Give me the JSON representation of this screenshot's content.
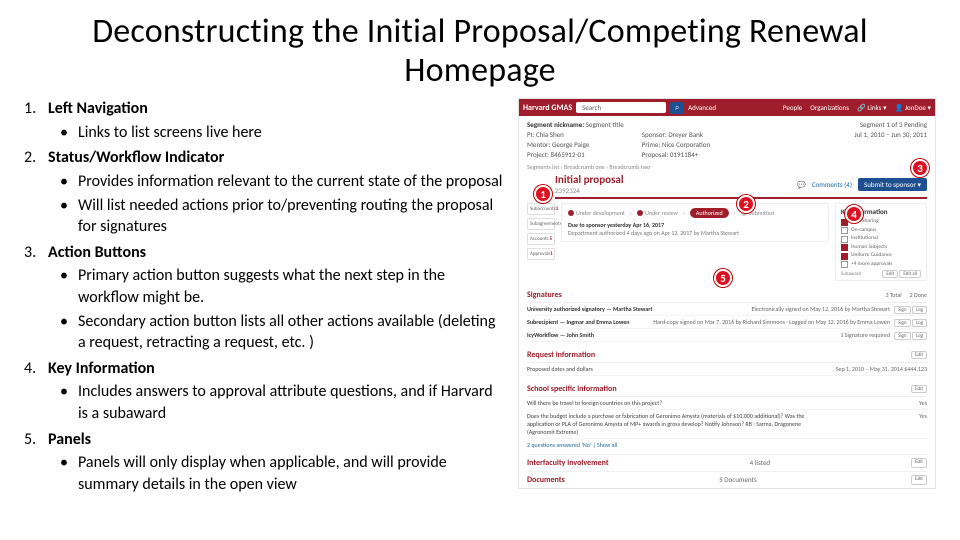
{
  "title": "Deconstructing the Initial Proposal/Competing Renewal Homepage",
  "outline": [
    {
      "head": "Left Navigation",
      "bullets": [
        "Links to list screens live here"
      ]
    },
    {
      "head": "Status/Workflow Indicator",
      "bullets": [
        "Provides information relevant to the current state of the proposal",
        "Will list needed actions prior to/preventing routing the proposal for signatures"
      ]
    },
    {
      "head": "Action Buttons",
      "bullets": [
        "Primary action button suggests what the next step in the workflow might be.",
        "Secondary action button lists all other actions available (deleting a request, retracting a request, etc. )"
      ]
    },
    {
      "head": "Key Information",
      "bullets": [
        "Includes answers to approval attribute questions, and if Harvard is a subaward"
      ]
    },
    {
      "head": "Panels",
      "bullets": [
        "Panels will only display when applicable, and will provide summary details in the open view"
      ]
    }
  ],
  "shot": {
    "brand": "Harvard GMAS",
    "search_placeholder": "Search",
    "advanced": "Advanced",
    "toplinks": [
      "People",
      "Organizations",
      "🔗 Links ▾",
      "👤 JonDoe ▾"
    ],
    "seg": {
      "nick_label": "Segment nickname:",
      "nick_val": "Segment title",
      "pi": "PI: Chia Shen",
      "mentor": "Mentor: George Paige",
      "project": "Project: 8465912-01",
      "sponsor": "Sponsor: Dreyer Bank",
      "prime": "Prime: Nice Corporation",
      "proposal": "Proposal: 0191184+",
      "segcount": "Segment 1 of 3   Pending",
      "dates": "Jul 1, 2010 – Jun 30, 2011"
    },
    "breadcrumb": "Segments list  ›  Breadcrumb one  ›  Breadcrumb two",
    "ip": {
      "title": "Initial proposal",
      "num": "2392324",
      "comments": "Comments (4)",
      "primary_btn": "Submit to sponsor"
    },
    "leftnav": [
      {
        "label": "Subaccounts",
        "n": "3"
      },
      {
        "label": "Subagreements",
        "n": "4"
      },
      {
        "label": "Accounts",
        "n": "5"
      },
      {
        "label": "Approvals",
        "n": "1"
      }
    ],
    "wf": {
      "steps": [
        {
          "label": "Under development",
          "done": true
        },
        {
          "label": "Under review",
          "done": true
        },
        {
          "label": "Authorized",
          "current": true
        },
        {
          "label": "Submitted",
          "done": false
        }
      ],
      "due": "Due to sponsor yesterday Apr 16, 2017",
      "detail": "Department authorized 4 days ago on Apr 12, 2017 by Martha Stewart"
    },
    "key": {
      "title": "Key information",
      "items": [
        {
          "label": "Cost Sharing",
          "on": true
        },
        {
          "label": "On-campus",
          "on": false
        },
        {
          "label": "Institutional",
          "on": false
        },
        {
          "label": "Human Subjects",
          "on": true
        },
        {
          "label": "Uniform Guidance",
          "on": true
        },
        {
          "label": "+4 more approvals",
          "on": false
        }
      ],
      "extra": "Subaward",
      "btn1": "Edit",
      "btn2": "Edit all"
    },
    "sign": {
      "title": "Signatures",
      "total": "3  Total",
      "done": "2  Done",
      "rows": [
        {
          "l": "University authorized signatory  —  Martha Stewart",
          "r": "Electronically signed on May 12, 2016 by Martha Stewart",
          "tags": [
            "Sign",
            "Log"
          ]
        },
        {
          "l": "Subrecipient  —  Ingmar and Emma Lowen",
          "r": "Hard-copy signed on Mar 7, 2016 by Richard Simmons · Logged on May 12, 2016 by Emma Lowen",
          "tags": [
            "Sign",
            "Log"
          ]
        },
        {
          "l": "IcyWorkflow  —  John Smith",
          "r": "1 Signature required",
          "tags": [
            "Sign",
            "Log"
          ]
        }
      ]
    },
    "req": {
      "title": "Request information",
      "edit": "Edit",
      "dates_label": "Proposed dates and dollars",
      "dates_val": "Sep 1, 2010 – May 31, 2014     $444,123"
    },
    "school": {
      "title": "School specific information",
      "edit": "Edit",
      "rows": [
        {
          "q": "Will there be travel to foreign countries on this project?",
          "a": "Yes"
        },
        {
          "q": "Does the budget include a purchase or fabrication of Geronimo Amysta (materials of $10,000 additional)? Was the application or PLA of Geronimo Amysta of MP+ awards in gross develop? Notify Johnson? RB · Sarma, Dragonene (Agronomit Extreme)",
          "a": "Yes"
        }
      ],
      "footer": "2 questions answered ‘No’ | Show all"
    },
    "inter": {
      "title": "Interfaculty involvement",
      "val": "4   listed",
      "edit": "Edit"
    },
    "docs": {
      "title": "Documents",
      "val": "5   Documents",
      "edit": "Edit"
    },
    "badges": [
      "1",
      "2",
      "3",
      "4",
      "5"
    ]
  }
}
